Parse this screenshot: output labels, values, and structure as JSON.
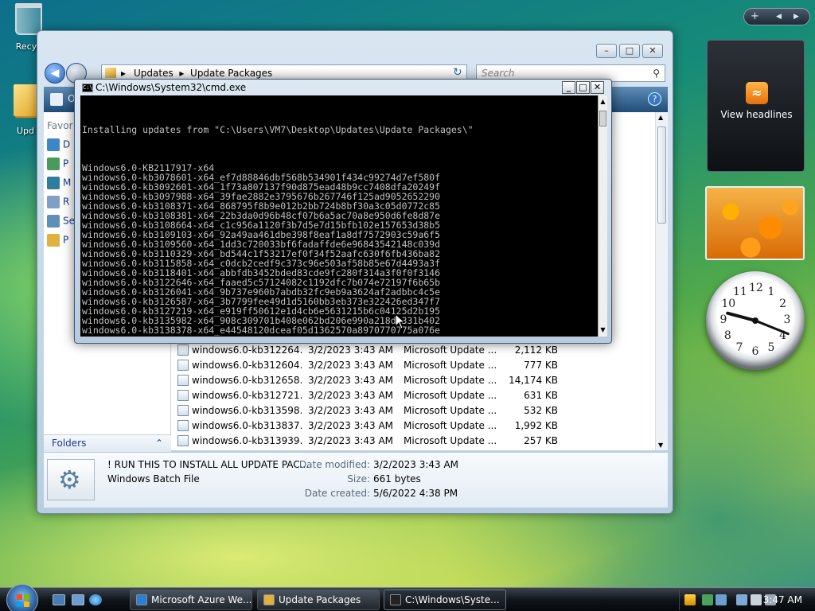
{
  "desktop": {
    "icons": [
      {
        "label": "Recyc"
      },
      {
        "label": "Upd"
      }
    ]
  },
  "explorer": {
    "breadcrumb": [
      "Updates",
      "Update Packages"
    ],
    "search_placeholder": "Search",
    "toolbar_initial": "O",
    "favorites_label": "Favor",
    "nav_items": [
      "D",
      "P",
      "M",
      "R",
      "Se",
      "P"
    ],
    "folders_label": "Folders",
    "files": [
      {
        "name": "windows6.0-kb312264...",
        "date": "3/2/2023 3:43 AM",
        "type": "Microsoft Update ...",
        "size": "2,112 KB"
      },
      {
        "name": "windows6.0-kb312604...",
        "date": "3/2/2023 3:43 AM",
        "type": "Microsoft Update ...",
        "size": "777 KB"
      },
      {
        "name": "windows6.0-kb312658...",
        "date": "3/2/2023 3:43 AM",
        "type": "Microsoft Update ...",
        "size": "14,174 KB"
      },
      {
        "name": "windows6.0-kb312721...",
        "date": "3/2/2023 3:43 AM",
        "type": "Microsoft Update ...",
        "size": "631 KB"
      },
      {
        "name": "windows6.0-kb313598...",
        "date": "3/2/2023 3:43 AM",
        "type": "Microsoft Update ...",
        "size": "532 KB"
      },
      {
        "name": "windows6.0-kb313837...",
        "date": "3/2/2023 3:43 AM",
        "type": "Microsoft Update ...",
        "size": "1,992 KB"
      },
      {
        "name": "windows6.0-kb313939...",
        "date": "3/2/2023 3:43 AM",
        "type": "Microsoft Update ...",
        "size": "257 KB"
      }
    ],
    "details": {
      "file_name": "! RUN THIS TO INSTALL ALL UPDATE PAC...",
      "file_type": "Windows Batch File",
      "modified_label": "Date modified:",
      "modified_value": "3/2/2023 3:43 AM",
      "size_label": "Size:",
      "size_value": "661 bytes",
      "created_label": "Date created:",
      "created_value": "5/6/2022 4:38 PM"
    }
  },
  "cmd": {
    "title": "C:\\Windows\\System32\\cmd.exe",
    "header": "Installing updates from \"C:\\Users\\VM7\\Desktop\\Updates\\Update Packages\\\"",
    "lines": [
      "Windows6.0-KB2117917-x64",
      "windows6.0-kb3078601-x64_ef7d88846dbf568b534901f434c99274d7ef580f",
      "windows6.0-kb3092601-x64_1f73a807137f90d875ead48b9cc7408dfa20249f",
      "windows6.0-kb3097988-x64_39fae2882e3795676b267746f125ad9052652290",
      "windows6.0-kb3108371-x64_868795f8b9e012b2bb724b8bf30a3c05d0772c85",
      "windows6.0-kb3108381-x64_22b3da0d96b48cf07b6a5ac70a8e950d6fe8d87e",
      "windows6.0-kb3108664-x64_c1c956a1120f3b7d5e7d15bfb102e157653d38b5",
      "windows6.0-kb3109103-x64_92a49aa461dbe398f8eaf1a8df7572903c59a6f5",
      "windows6.0-kb3109560-x64_1dd3c720033bf6fadaffde6e96843542148c039d",
      "windows6.0-kb3110329-x64_bd544c1f53217ef0f34f52aafc630f6fb436ba82",
      "windows6.0-kb3115858-x64_c0dcb2cedf9c373c96e503af58b85e67d4493a3f",
      "windows6.0-kb3118401-x64_abbfdb3452bded83cde9fc280f314a3f0f0f3146",
      "windows6.0-kb3122646-x64_faaed5c57124082c1192dfc7b074e72197f6b65b",
      "windows6.0-kb3126041-x64_9b737e960b7abdb32fc9eb9a3624af2adbbc4c5e",
      "windows6.0-kb3126587-x64_3b7799fee49d1d5160bb3eb373e322426ed347f7",
      "windows6.0-kb3127219-x64_e919ff50612e1d4cb6e5631215b6c04125d2b195",
      "windows6.0-kb3135982-x64_908c309701b408e062bd206e990a218d1331b402",
      "windows6.0-kb3138378-x64_e44548120dceaf05d1362570a8970770775a076e"
    ]
  },
  "gadgets": {
    "feed_label": "View headlines",
    "clock_numbers": [
      "12",
      "1",
      "2",
      "3",
      "4",
      "5",
      "6",
      "7",
      "8",
      "9",
      "10",
      "11"
    ]
  },
  "taskbar": {
    "buttons": [
      {
        "label": "Microsoft Azure We...",
        "active": false
      },
      {
        "label": "Update Packages",
        "active": false
      },
      {
        "label": "C:\\Windows\\Syste...",
        "active": true
      }
    ],
    "time": "3:47 AM"
  },
  "colors": {
    "console_bg": "#000000",
    "console_fg": "#c0c0c0",
    "link_blue": "#1b3a8f",
    "taskbar": "#11161b"
  }
}
